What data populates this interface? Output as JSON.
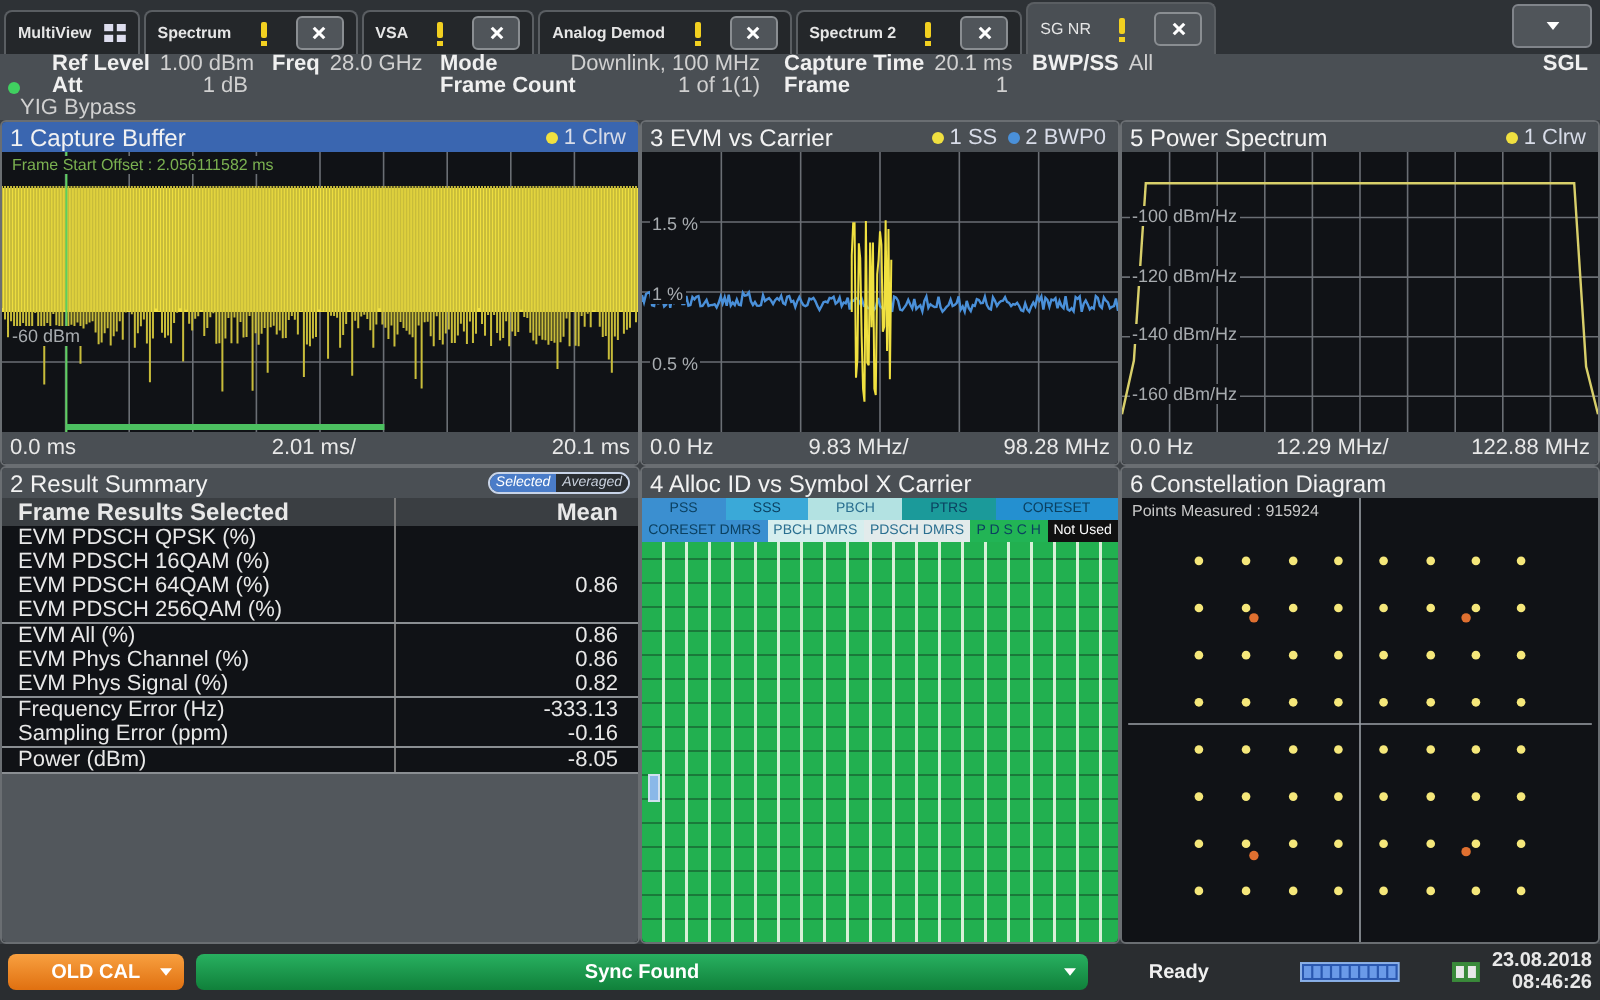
{
  "tabs": [
    {
      "label": "MultiView",
      "kind": "overview",
      "selected": false
    },
    {
      "label": "Spectrum",
      "kind": "channel",
      "selected": false
    },
    {
      "label": "VSA",
      "kind": "channel",
      "selected": false
    },
    {
      "label": "Analog Demod",
      "kind": "channel",
      "selected": false
    },
    {
      "label": "Spectrum 2",
      "kind": "channel",
      "selected": false
    },
    {
      "label": "SG NR",
      "kind": "channel",
      "selected": true
    }
  ],
  "info": {
    "ref_level": {
      "label": "Ref Level",
      "value": "1.00 dBm"
    },
    "freq": {
      "label": "Freq",
      "value": "28.0 GHz"
    },
    "mode": {
      "label": "Mode",
      "value": "Downlink, 100 MHz"
    },
    "capture_time": {
      "label": "Capture Time",
      "value": "20.1 ms"
    },
    "bwp_ss": {
      "label": "BWP/SS",
      "value": "All"
    },
    "sgl": "SGL",
    "att": {
      "label": "Att",
      "value": "1 dB"
    },
    "frame_count": {
      "label": "Frame Count",
      "value": "1 of 1(1)"
    },
    "frame": {
      "label": "Frame",
      "value": "1"
    },
    "yig_bypass": "YIG Bypass"
  },
  "panels": [
    {
      "kind": "capture",
      "title": "1 Capture Buffer",
      "active": true,
      "legend": [
        {
          "label": "1 Clrw",
          "color": "#f0e040"
        }
      ],
      "annotation": "Frame Start Offset : 2.056111582 ms",
      "y_labels": [
        "-60 dBm"
      ],
      "x_labels": [
        "0.0 ms",
        "2.01 ms/",
        "20.1 ms"
      ]
    },
    {
      "kind": "evm",
      "title": "3 EVM vs Carrier",
      "active": false,
      "legend": [
        {
          "label": "1 SS",
          "color": "#f0e040"
        },
        {
          "label": "2 BWP0",
          "color": "#4a90d9"
        }
      ],
      "y_labels": [
        "1.5 %",
        "1 %",
        "0.5 %"
      ],
      "x_labels": [
        "0.0 Hz",
        "9.83 MHz/",
        "98.28 MHz"
      ]
    },
    {
      "kind": "spectrum",
      "title": "5 Power Spectrum",
      "active": false,
      "legend": [
        {
          "color": "#f0e040"
        }
      ],
      "x_labels": [
        "0.0 Hz",
        "12.29 MHz/",
        "122.88 MHz"
      ],
      "chart_data": {
        "type": "line",
        "categories": [
          null,
          null,
          null,
          null,
          null,
          null,
          null,
          null,
          null,
          null,
          null,
          null,
          null,
          null,
          null,
          null,
          null,
          null,
          null,
          null,
          null,
          null,
          null,
          null,
          null,
          null,
          null,
          null,
          null,
          null,
          null,
          null,
          null,
          null,
          null,
          null,
          null,
          null,
          null,
          null,
          null
        ],
        "series": [
          {
            "name": "1 Clrw",
            "color": "#d8cf6a",
            "values": [
              -166,
              -148,
              -88.5,
              -88.5,
              -88.5,
              -88.5,
              -88.5,
              -88.5,
              -88.5,
              -88.5,
              -88.5,
              -88.5,
              -88.5,
              -88.5,
              -88.5,
              -88.5,
              -88.5,
              -88.5,
              -88.5,
              -88.5,
              -88.5,
              -88.5,
              -88.5,
              -88.5,
              -88.5,
              -88.5,
              -88.5,
              -88.5,
              -88.5,
              -88.5,
              -88.5,
              -88.5,
              -88.5,
              -88.5,
              -88.5,
              -88.5,
              -88.5,
              -88.5,
              -88.5,
              -150,
              -166
            ]
          }
        ],
        "ylim": [
          -172,
          -78
        ],
        "grid": true,
        "yticks": [
          {
            "value": -100,
            "label": "-100 dBm/Hz"
          },
          {
            "value": -120,
            "label": "-120 dBm/Hz"
          },
          {
            "value": -140,
            "label": "-140 dBm/Hz"
          },
          {
            "value": -160,
            "label": "-160 dBm/Hz"
          }
        ]
      }
    },
    {
      "kind": "results",
      "title": "2 Result Summary",
      "active": false,
      "toggle": [
        {
          "label": "Selected",
          "selected": true
        },
        {
          "label": "Averaged",
          "selected": false
        }
      ],
      "columns": [
        "Frame Results Selected",
        "Mean"
      ],
      "groups": [
        [
          {
            "label": "EVM PDSCH QPSK (%)"
          },
          {
            "label": "EVM PDSCH 16QAM (%)"
          },
          {
            "label": "EVM PDSCH 64QAM (%)",
            "value": "0.86"
          },
          {
            "label": "EVM PDSCH 256QAM (%)"
          }
        ],
        [
          {
            "label": "EVM All (%)",
            "value": "0.86"
          },
          {
            "label": "EVM Phys Channel (%)",
            "value": "0.86"
          },
          {
            "label": "EVM Phys Signal (%)",
            "value": "0.82"
          }
        ],
        [
          {
            "label": "Frequency Error (Hz)",
            "value": "-333.13"
          },
          {
            "label": "Sampling Error (ppm)",
            "value": "-0.16"
          }
        ],
        [
          {
            "label": "Power (dBm)",
            "value": "-8.05"
          }
        ]
      ]
    },
    {
      "kind": "alloc",
      "title": "4 Alloc ID vs Symbol X Carrier",
      "active": false,
      "legend_rows": [
        [
          {
            "label": "PSS",
            "color": "#3b8fd0"
          },
          {
            "label": "SSS",
            "color": "#3aa9d8"
          },
          {
            "label": "PBCH",
            "color": "#b3e2e2"
          },
          {
            "label": "PTRS",
            "color": "#1b9a9a"
          },
          {
            "label": "CORESET",
            "color": "#2490d0"
          }
        ],
        [
          {
            "label": "CORESET DMRS",
            "color": "#3a8fd0"
          },
          {
            "label": "PBCH DMRS",
            "color": "#d6eeee"
          },
          {
            "label": "PDSCH DMRS",
            "color": "#e2ebeb"
          },
          {
            "label": "P D S C H",
            "color": "#22b455"
          },
          {
            "label": "Not Used",
            "color": "#101010"
          }
        ]
      ]
    },
    {
      "kind": "constellation",
      "title": "6 Constellation Diagram",
      "active": false,
      "annotation": "Points Measured : 915924"
    }
  ],
  "status_bar": {
    "calibration": "OLD CAL",
    "sync": "Sync Found",
    "state": "Ready",
    "date": "23.08.2018",
    "time": "08:46:26"
  }
}
